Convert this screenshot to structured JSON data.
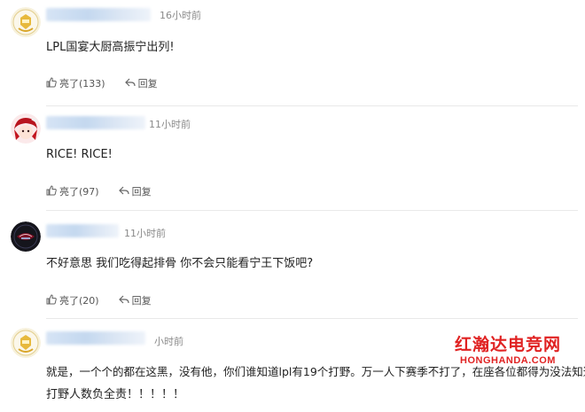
{
  "comments": [
    {
      "time": "16小时前",
      "text": "LPL国宴大厨高振宁出列!",
      "like_label": "亮了(133)",
      "reply_label": "回复",
      "avatar_icon": "gold-badge-avatar-icon"
    },
    {
      "time": "11小时前",
      "text": "RICE!  RICE!",
      "like_label": "亮了(97)",
      "reply_label": "回复",
      "avatar_icon": "anime-girl-avatar-icon"
    },
    {
      "time": "11小时前",
      "text": "不好意思 我们吃得起排骨 你不会只能看宁王下饭吧?",
      "like_label": "亮了(20)",
      "reply_label": "回复",
      "avatar_icon": "team-logo-avatar-icon"
    },
    {
      "time": "小时前",
      "text_line1": "就是，一个个的都在这黑，没有他，你们谁知道lpl有19个打野。万一人下赛季不打了，在座各位都得为没法知道lpl",
      "text_line2": "打野人数负全责！！！！！",
      "avatar_icon": "gold-badge-avatar-icon"
    }
  ],
  "watermark": {
    "cn": "红瀚达电竞网",
    "en": "HONGHANDA.COM"
  },
  "colors": {
    "text": "#222222",
    "time": "#8a8a8a",
    "action": "#555555",
    "watermark": "#e02222"
  }
}
